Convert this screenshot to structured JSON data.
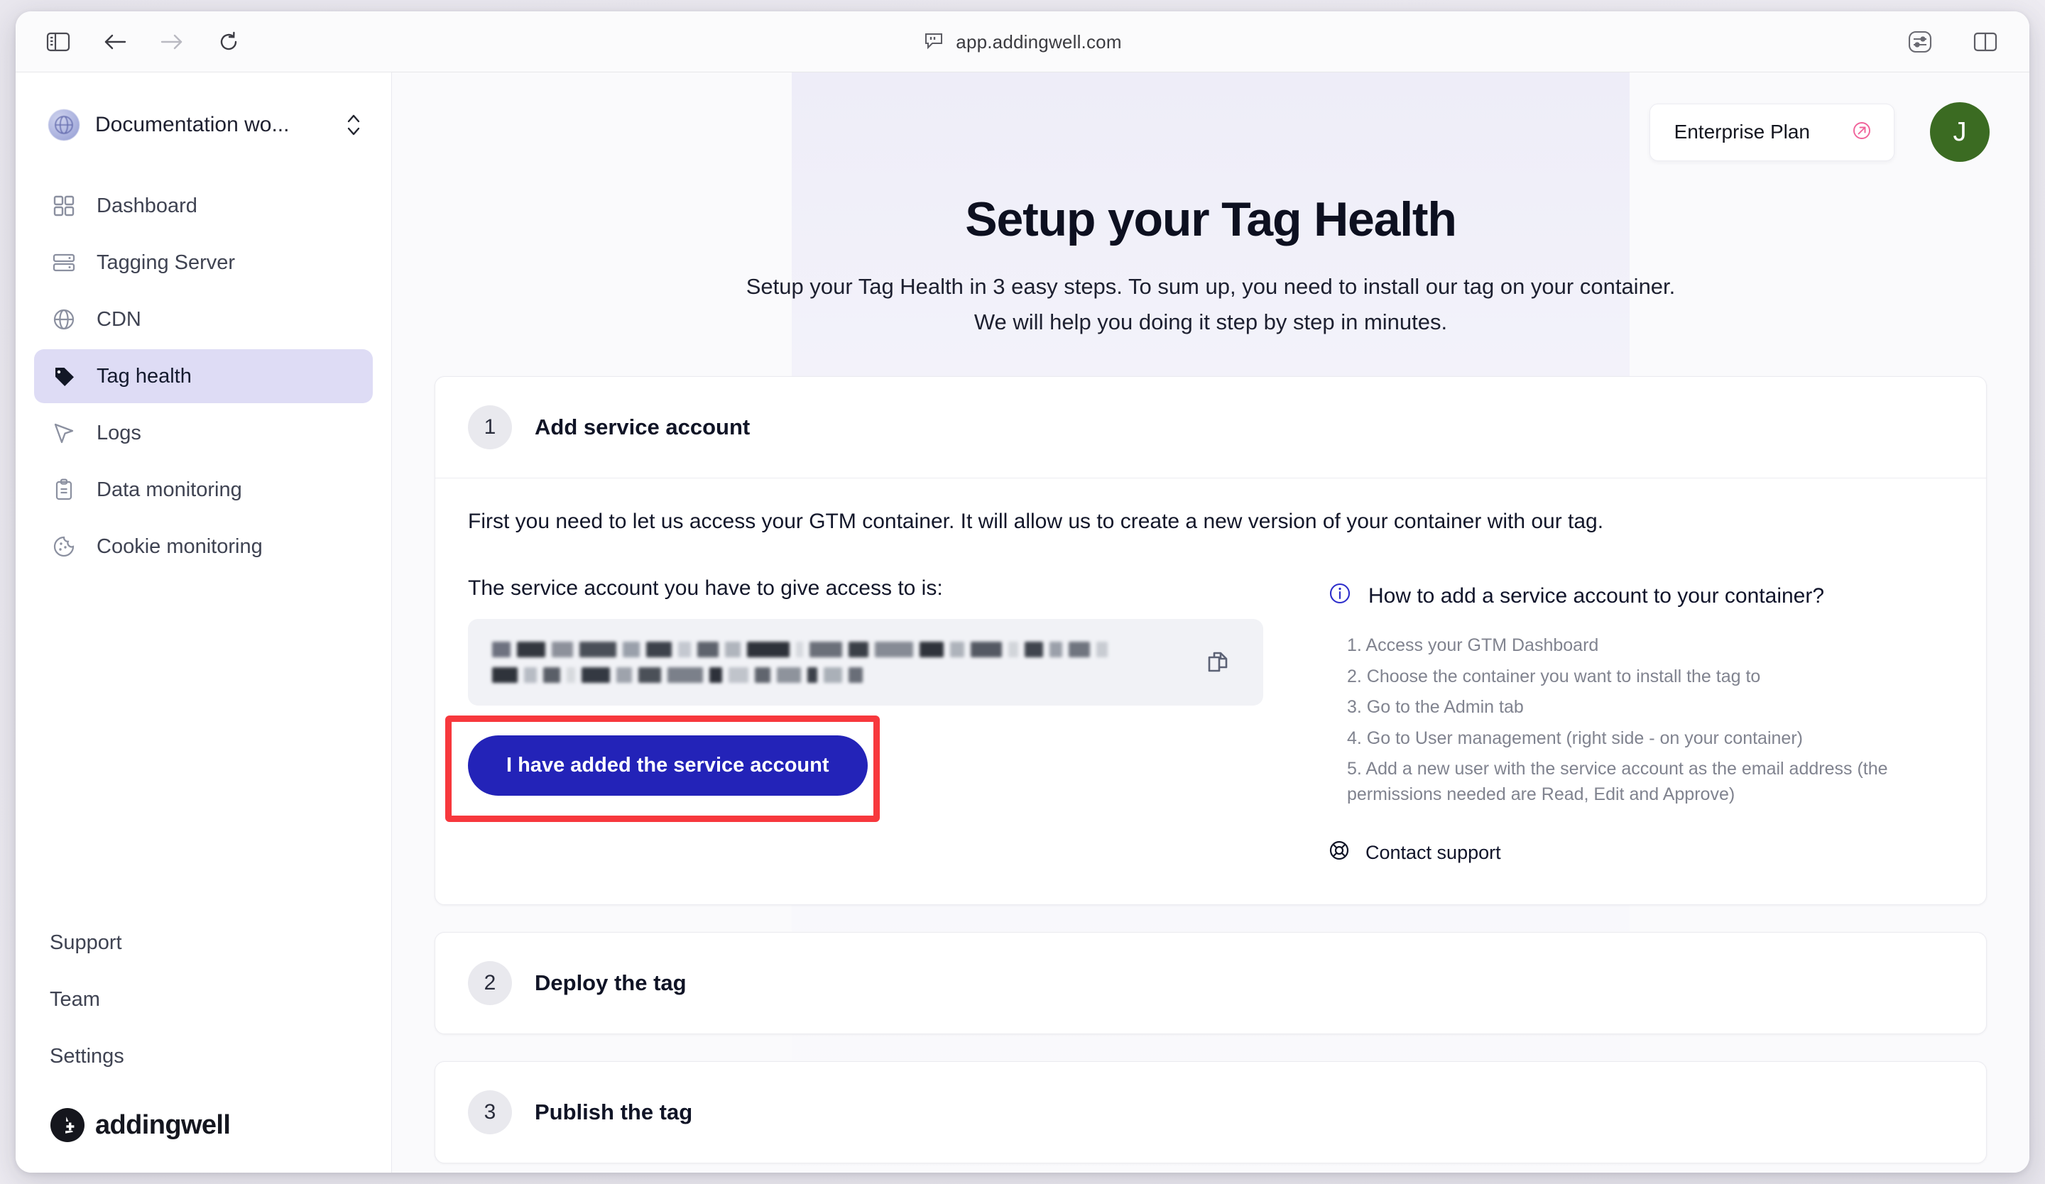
{
  "browser": {
    "url": "app.addingwell.com",
    "icons": {
      "sidebar_toggle": "sidebar-toggle-icon",
      "back": "back-arrow-icon",
      "forward": "forward-arrow-icon",
      "reload": "reload-icon",
      "url_prefix": "speech-bubble-icon",
      "settings": "sliders-icon",
      "split_view": "split-view-icon"
    }
  },
  "sidebar": {
    "workspace": {
      "name": "Documentation wo...",
      "icon": "globe-icon"
    },
    "items": [
      {
        "label": "Dashboard",
        "icon": "grid-icon",
        "active": false
      },
      {
        "label": "Tagging Server",
        "icon": "server-icon",
        "active": false
      },
      {
        "label": "CDN",
        "icon": "globe-icon",
        "active": false
      },
      {
        "label": "Tag health",
        "icon": "tag-icon",
        "active": true
      },
      {
        "label": "Logs",
        "icon": "cursor-icon",
        "active": false
      },
      {
        "label": "Data monitoring",
        "icon": "clipboard-icon",
        "active": false
      },
      {
        "label": "Cookie monitoring",
        "icon": "cookie-icon",
        "active": false
      }
    ],
    "bottom_items": [
      {
        "label": "Support"
      },
      {
        "label": "Team"
      },
      {
        "label": "Settings"
      }
    ],
    "brand": "addingwell"
  },
  "topbar": {
    "plan_label": "Enterprise Plan",
    "plan_icon": "arrow-up-right-circle-icon",
    "avatar_initial": "J"
  },
  "main": {
    "title": "Setup your Tag Health",
    "subtitle_line1": "Setup your Tag Health in 3 easy steps. To sum up, you need to install our tag on your container.",
    "subtitle_line2": "We will help you doing it step by step in minutes."
  },
  "steps": [
    {
      "number": "1",
      "title": "Add service account",
      "expanded": true,
      "intro": "First you need to let us access your GTM container. It will allow us to create a new version of your container with our tag.",
      "service_account_label": "The service account you have to give access to is:",
      "service_account_value": "",
      "service_account_redacted": true,
      "copy_icon": "copy-icon",
      "cta_label": "I have added the service account",
      "info": {
        "icon": "info-circle-icon",
        "title": "How to add a service account to your container?",
        "steps": [
          "1. Access your GTM Dashboard",
          "2. Choose the container you want to install the tag to",
          "3. Go to the Admin tab",
          "4. Go to User management (right side - on your container)",
          "5. Add a new user with the service account as the email address (the permissions needed are Read, Edit and Approve)"
        ],
        "support_label": "Contact support",
        "support_icon": "life-ring-icon"
      }
    },
    {
      "number": "2",
      "title": "Deploy the tag",
      "expanded": false
    },
    {
      "number": "3",
      "title": "Publish the tag",
      "expanded": false
    }
  ],
  "colors": {
    "accent_blue": "#2323b8",
    "highlight_red": "#f7383d",
    "sidebar_active_bg": "#dedcf5",
    "avatar_green": "#3b6b22",
    "plan_icon_pink": "#f0639a"
  }
}
